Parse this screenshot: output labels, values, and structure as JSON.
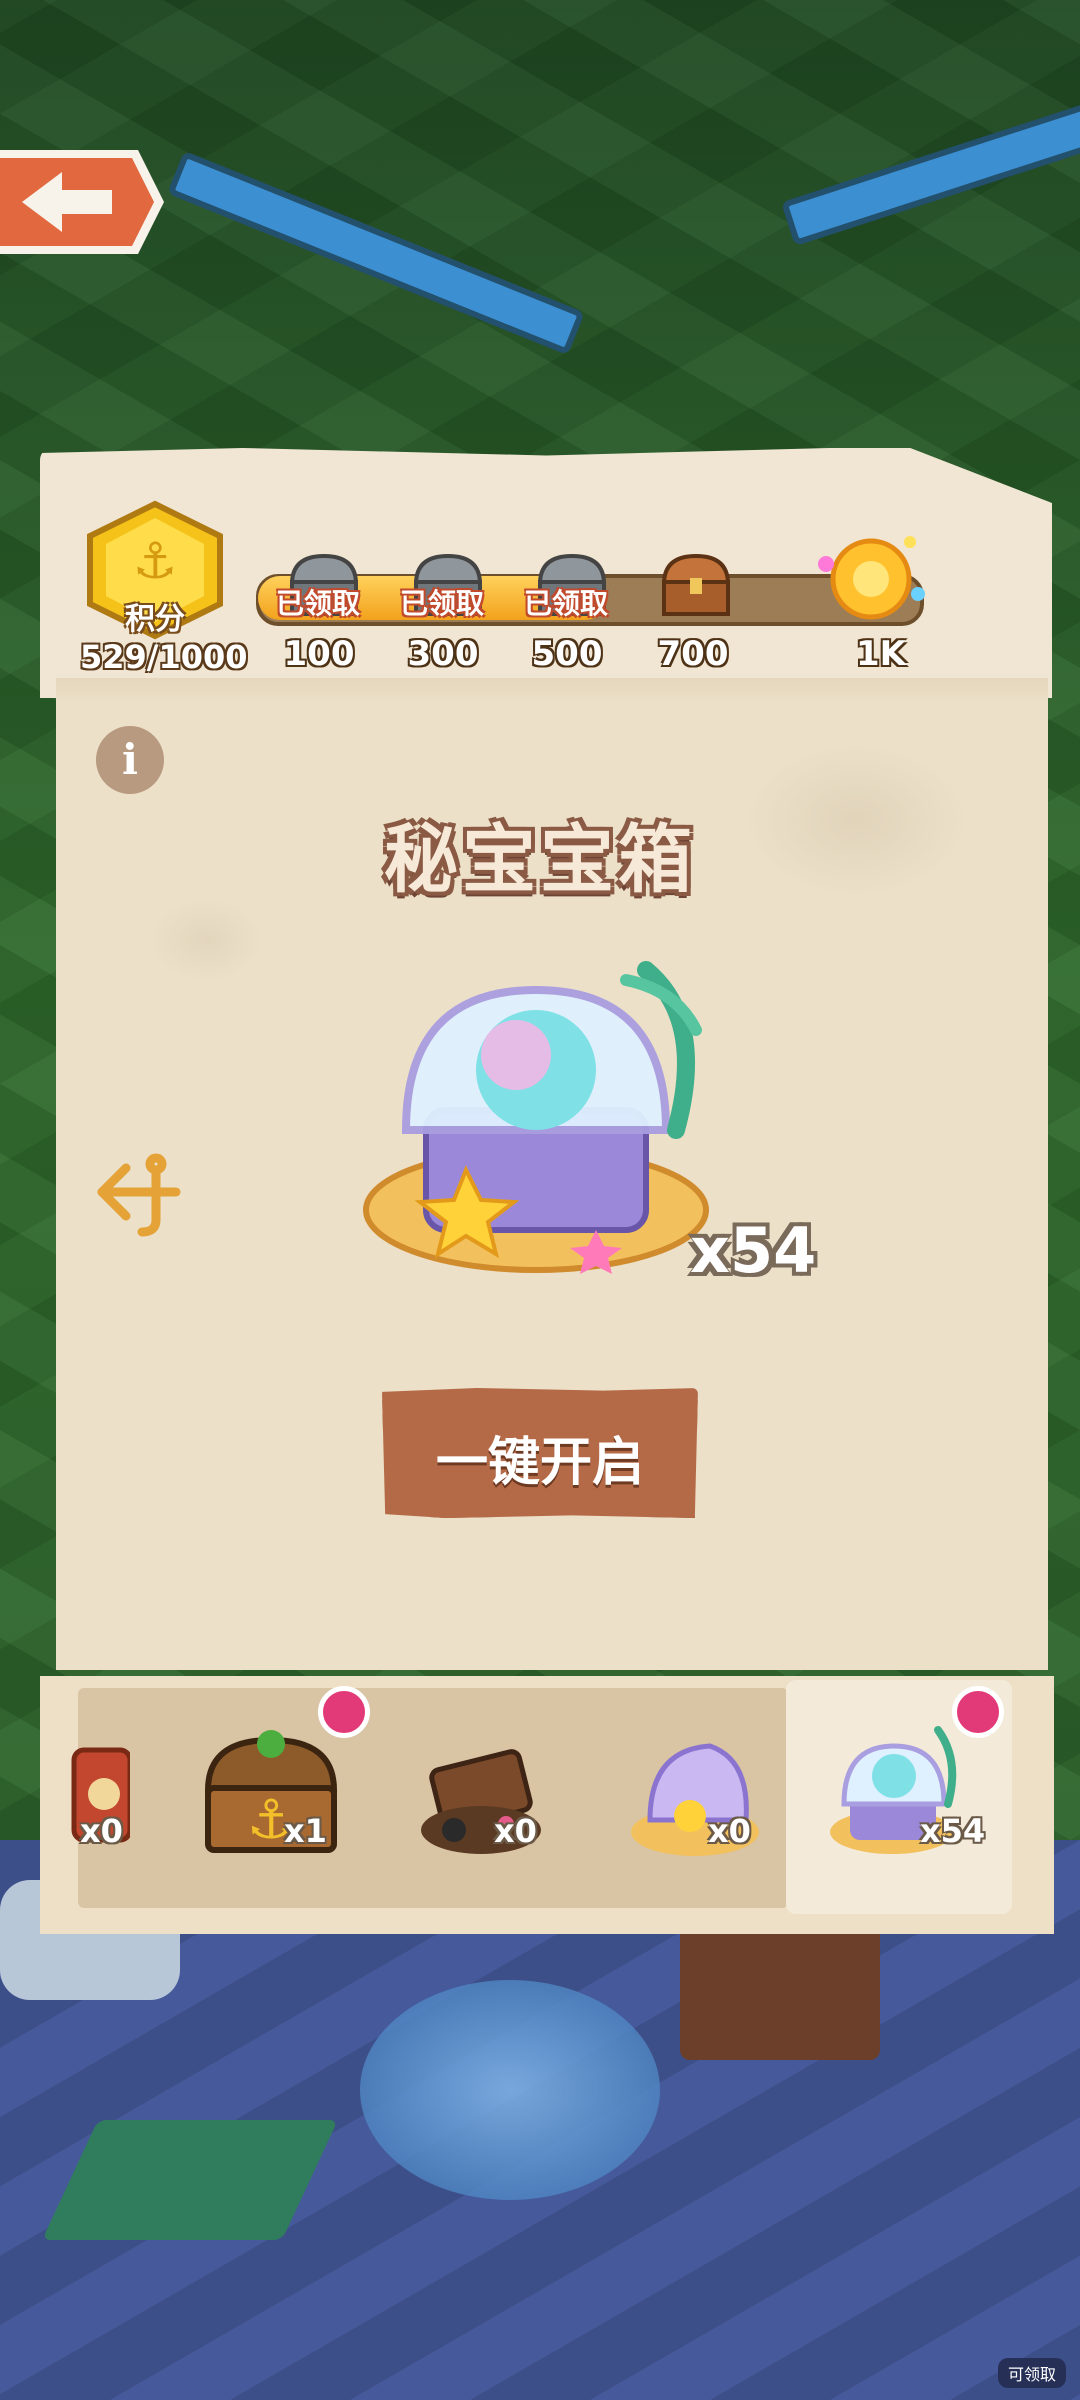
{
  "header": {
    "points_label": "积分",
    "points_value": "529/1000",
    "progress_fraction": 0.529,
    "milestones": [
      {
        "value": "100",
        "status": "已领取",
        "icon": "silver-chest-icon"
      },
      {
        "value": "300",
        "status": "已领取",
        "icon": "silver-chest-icon"
      },
      {
        "value": "500",
        "status": "已领取",
        "icon": "silver-chest-icon"
      },
      {
        "value": "700",
        "status": "",
        "icon": "wooden-chest-icon"
      },
      {
        "value": "1K",
        "status": "",
        "icon": "golden-flower-icon"
      }
    ]
  },
  "main": {
    "info_icon": "i",
    "title": "秘宝宝箱",
    "chest_count": "x54",
    "open_all_label": "一键开启"
  },
  "tray": {
    "items": [
      {
        "name": "red-chest",
        "count": "x0",
        "has_dot": false
      },
      {
        "name": "anchor-treasure-chest",
        "count": "x1",
        "has_dot": true
      },
      {
        "name": "pirate-chest",
        "count": "x0",
        "has_dot": false
      },
      {
        "name": "shell-chest",
        "count": "x0",
        "has_dot": false
      },
      {
        "name": "rainbow-chest",
        "count": "x54",
        "has_dot": true,
        "selected": true
      }
    ]
  },
  "background": {
    "claimable_label": "可领取"
  },
  "colors": {
    "parchment": "#ece0c8",
    "button": "#b56a47",
    "progress": "#f2a21c",
    "badge_dot": "#e23a78"
  }
}
